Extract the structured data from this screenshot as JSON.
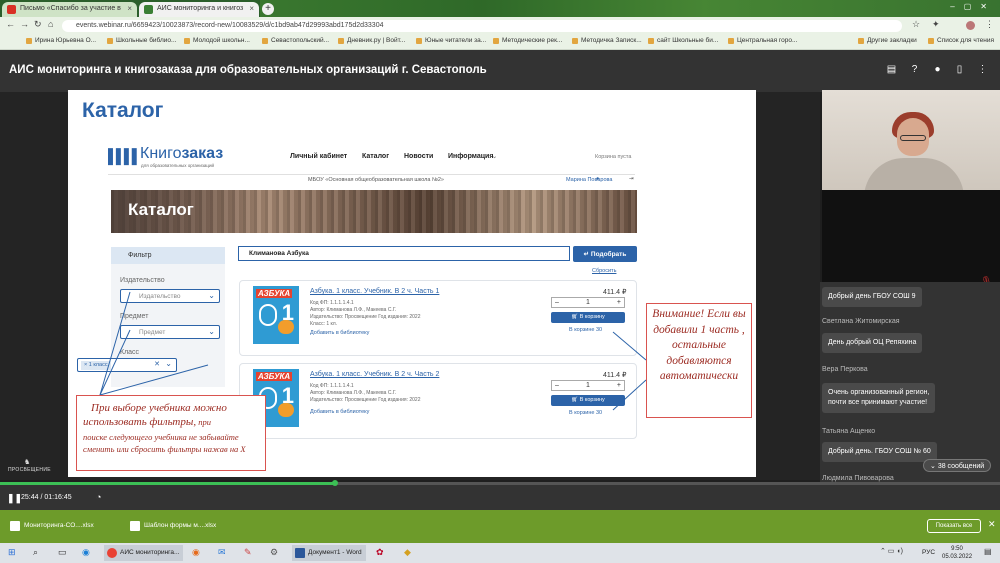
{
  "browser": {
    "tabs": [
      {
        "label": "Письмо «Спасибо за участие в"
      },
      {
        "label": "АИС мониторинга и книгоз"
      }
    ],
    "url": "events.webinar.ru/6659423/10023873/record-new/10083529/d/c1bd9ab47d29993abd175d2d33304",
    "bookmarks": [
      "Ирина Юрьевна О...",
      "Школьные библио...",
      "Молодой школьн...",
      "Севастопольский...",
      "Дневник.ру | Войт...",
      "Юные читатели за...",
      "Методические рек...",
      "Методичка Записк...",
      "сайт Школьные би...",
      "Центральная горо...",
      "Другие закладки",
      "Список для чтения"
    ]
  },
  "app": {
    "title": "АИС мониторинга и книгозаказа для образовательных организаций г. Севастополь"
  },
  "slide": {
    "title": "Каталог",
    "site": {
      "logo_part1": "Книго",
      "logo_part2": "заказ",
      "logo_sub": "для образовательных организаций",
      "nav": [
        "Личный кабинет",
        "Каталог",
        "Новости",
        "Информация"
      ],
      "cart_status": "Корзина пуста",
      "school": "МБОУ «Основная общеобразовательная школа №2»",
      "user": "Марина Поварова",
      "banner_title": "Каталог",
      "filter": {
        "header": "Фильтр",
        "publisher_label": "Издательство",
        "publisher_placeholder": "Издательство",
        "subject_label": "Предмет",
        "subject_placeholder": "Предмет",
        "class_label": "Класс",
        "class_chip": "× 1 класс"
      },
      "search_value": "Климанова Азбука",
      "search_button": "Подобрать",
      "reset_link": "Сбросить",
      "products": [
        {
          "title": "Азбука. 1 класс. Учебник. В 2 ч. Часть 1",
          "code": "Код ФП: 1.1.1.1.4.1",
          "author": "Автор: Климанова Л.Ф., Макеева С.Г.",
          "publisher": "Издательство: Просвещение   Год издания: 2022",
          "grade": "Класс: 1 кл.",
          "price": "411.4 ₽",
          "qty": "1",
          "cart_button": "В корзину",
          "in_cart": "В корзине 30",
          "library": "Добавить в библиотеку"
        },
        {
          "title": "Азбука. 1 класс. Учебник. В 2 ч. Часть 2",
          "code": "Код ФП: 1.1.1.1.4.1",
          "author": "Автор: Климанова Л.Ф., Макеева С.Г.",
          "publisher": "Издательство: Просвещение   Год издания: 2022",
          "grade": "",
          "price": "411.4 ₽",
          "qty": "1",
          "cart_button": "В корзину",
          "in_cart": "В корзине 30",
          "library": "Добавить в библиотеку"
        }
      ],
      "cover_title": "АЗБУКА",
      "cover_number": "1"
    },
    "note_left": {
      "line1": "При выборе учебника можно",
      "line2": "использовать фильтры,",
      "line2b": " при",
      "line3": "поиске следующего учебника не забывайте сменить или сбросить фильтры нажав на Х"
    },
    "note_right": "Внимание! Если вы добавили 1 часть , остальные добавляются автоматически",
    "footer_logo": "ПРОСВЕЩЕНИЕ"
  },
  "chat": {
    "messages": [
      {
        "name": "",
        "text": "Добрый день ГБОУ СОШ 9"
      },
      {
        "name": "Светлана Житомирская",
        "text": "День добрый ОЦ Репяхина"
      },
      {
        "name": "Вера Перкова",
        "text": "Очень организованный регион,"
      },
      {
        "name": "",
        "text": "почти все принимают участие!"
      },
      {
        "name": "Татьяна Ащенко",
        "text": "Добрый день. ГБОУ СОШ № 60"
      },
      {
        "name": "Людмила Пивоварова",
        "text": ""
      }
    ],
    "badge": "38 сообщений"
  },
  "player": {
    "time": "25:44 / 01:16:45",
    "progress": 0.335
  },
  "downloads": {
    "items": [
      "Мониторинга-СО....xlsx",
      "Шаблон формы м....xlsx"
    ],
    "show_all": "Показать все"
  },
  "taskbar": {
    "apps": [
      "АИС мониторинга...",
      "Документ1 - Word"
    ],
    "lang": "РУС",
    "time": "9:50",
    "date": "05.03.2022"
  }
}
